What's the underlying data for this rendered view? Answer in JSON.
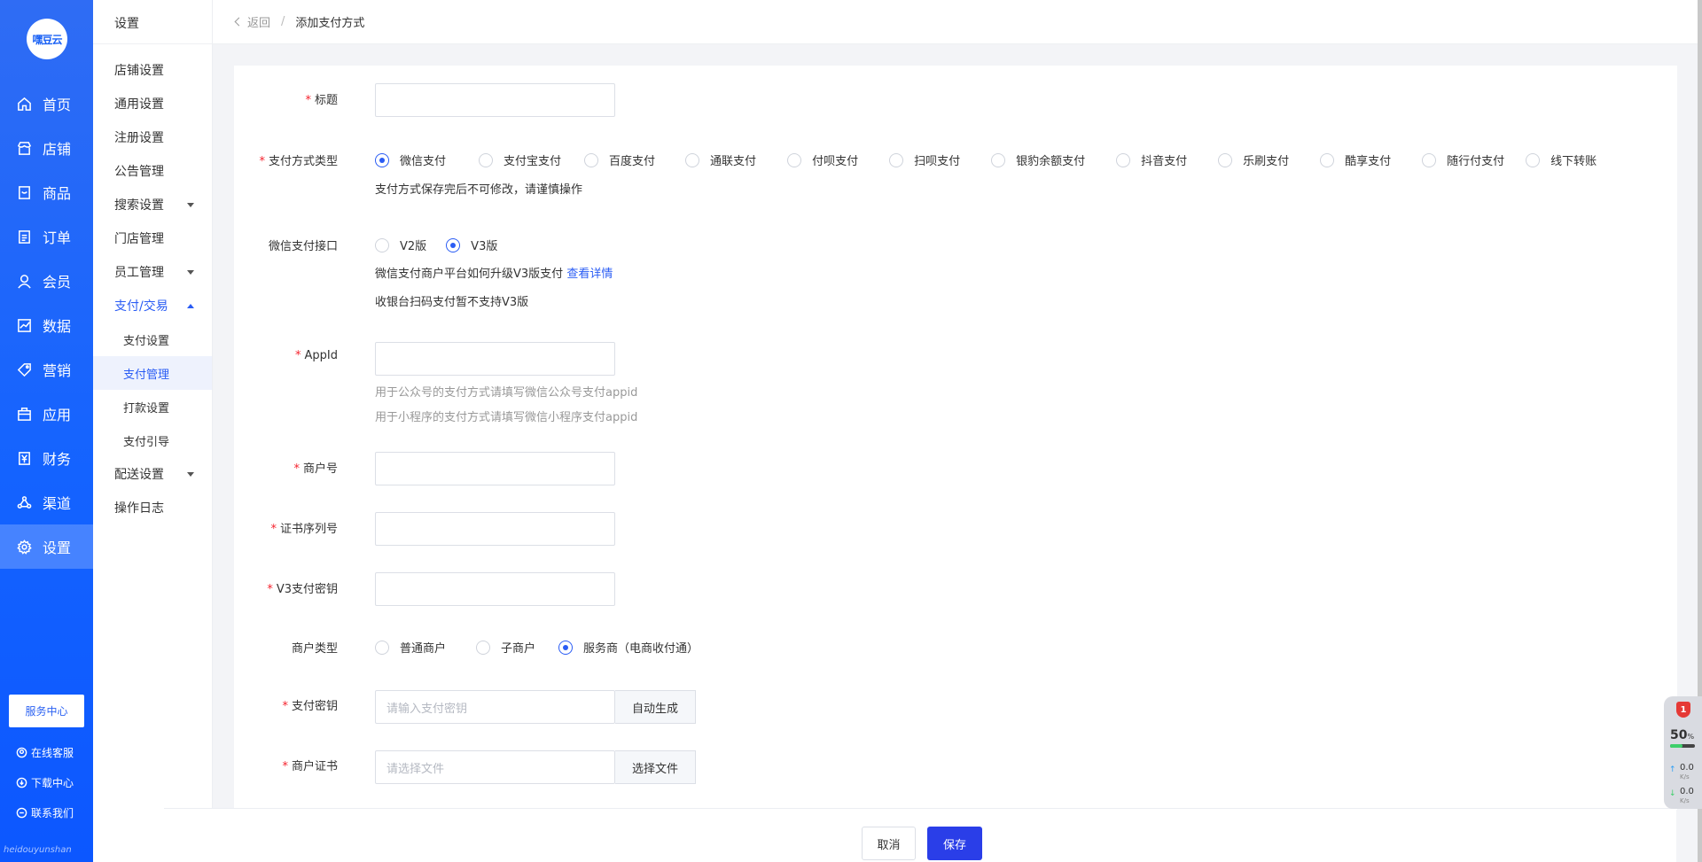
{
  "brand": {
    "logo_text": "嘿豆云",
    "bottom_text": "heidouyunshan"
  },
  "nav": {
    "items": [
      {
        "label": "首页",
        "icon": "home-icon"
      },
      {
        "label": "店铺",
        "icon": "store-icon"
      },
      {
        "label": "商品",
        "icon": "goods-icon"
      },
      {
        "label": "订单",
        "icon": "order-icon"
      },
      {
        "label": "会员",
        "icon": "member-icon"
      },
      {
        "label": "数据",
        "icon": "chart-icon"
      },
      {
        "label": "营销",
        "icon": "tag-icon"
      },
      {
        "label": "应用",
        "icon": "app-icon"
      },
      {
        "label": "财务",
        "icon": "finance-icon"
      },
      {
        "label": "渠道",
        "icon": "channel-icon"
      },
      {
        "label": "设置",
        "icon": "gear-icon"
      }
    ],
    "active": "设置",
    "service_center": "服务中心",
    "links": [
      {
        "label": "在线客服",
        "icon": "support-icon"
      },
      {
        "label": "下载中心",
        "icon": "download-icon"
      },
      {
        "label": "联系我们",
        "icon": "contact-icon"
      }
    ]
  },
  "subnav": {
    "title": "设置",
    "items": [
      {
        "label": "店铺设置"
      },
      {
        "label": "通用设置"
      },
      {
        "label": "注册设置"
      },
      {
        "label": "公告管理"
      },
      {
        "label": "搜索设置"
      },
      {
        "label": "门店管理"
      },
      {
        "label": "员工管理"
      },
      {
        "label": "支付/交易"
      },
      {
        "label": "支付设置"
      },
      {
        "label": "支付管理"
      },
      {
        "label": "打款设置"
      },
      {
        "label": "支付引导"
      },
      {
        "label": "配送设置"
      },
      {
        "label": "操作日志"
      }
    ]
  },
  "breadcrumb": {
    "back": "返回",
    "separator": "/",
    "current": "添加支付方式"
  },
  "form": {
    "title": {
      "label": "标题",
      "value": ""
    },
    "pay_type": {
      "label": "支付方式类型",
      "options": [
        "微信支付",
        "支付宝支付",
        "百度支付",
        "通联支付",
        "付呗支付",
        "扫呗支付",
        "银豹余额支付",
        "抖音支付",
        "乐刷支付",
        "酷享支付",
        "随行付支付",
        "线下转账"
      ],
      "selected": "微信支付",
      "note": "支付方式保存完后不可修改，请谨慎操作"
    },
    "wx_api": {
      "label": "微信支付接口",
      "options": [
        "V2版",
        "V3版"
      ],
      "selected": "V3版",
      "note1": "微信支付商户平台如何升级V3版支付",
      "note1_link": "查看详情",
      "note2": "收银台扫码支付暂不支持V3版"
    },
    "appid": {
      "label": "AppId",
      "value": "",
      "hint1": "用于公众号的支付方式请填写微信公众号支付appid",
      "hint2": "用于小程序的支付方式请填写微信小程序支付appid"
    },
    "mch_id": {
      "label": "商户号",
      "value": ""
    },
    "cert_serial": {
      "label": "证书序列号",
      "value": ""
    },
    "v3_key": {
      "label": "V3支付密钥",
      "value": ""
    },
    "mch_type": {
      "label": "商户类型",
      "options": [
        "普通商户",
        "子商户",
        "服务商（电商收付通）"
      ],
      "selected": "服务商（电商收付通）"
    },
    "pay_key": {
      "label": "支付密钥",
      "placeholder": "请输入支付密钥",
      "button": "自动生成"
    },
    "mch_cert": {
      "label": "商户证书",
      "placeholder": "请选择文件",
      "button": "选择文件"
    }
  },
  "footer": {
    "cancel": "取消",
    "save": "保存"
  },
  "widget": {
    "badge": "1",
    "percent": "50",
    "percent_unit": "%",
    "up": "0.0",
    "down": "0.0",
    "unit": "K/s"
  },
  "colors": {
    "primary": "#2a5cf4",
    "nav_bg": "#1463ff",
    "save_button": "#2a3ee8",
    "required": "#f5222d"
  }
}
